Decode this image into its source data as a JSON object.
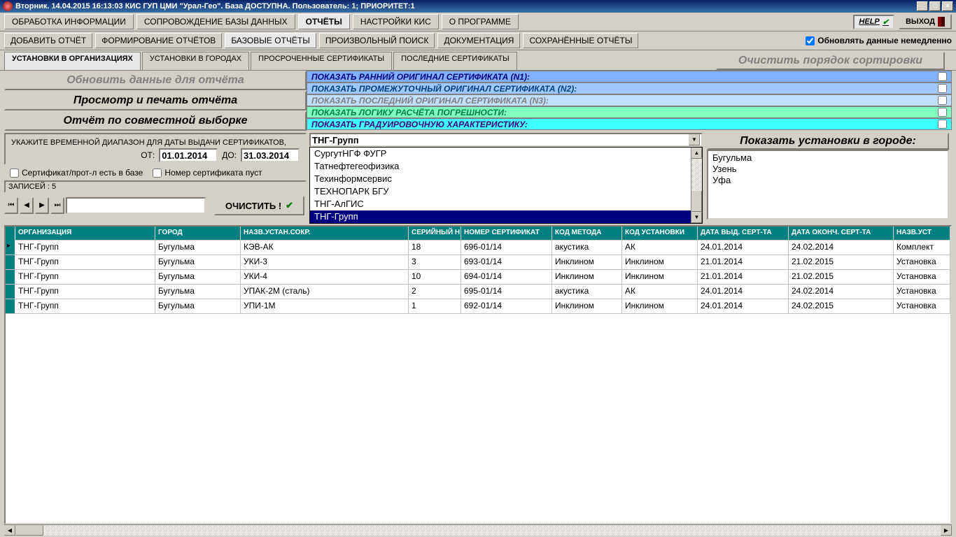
{
  "titlebar": "Вторник. 14.04.2015 16:13:03 КИС ГУП ЦМИ \"Урал-Гео\". База ДОСТУПНА. Пользователь: 1; ПРИОРИТЕТ:1",
  "menu": {
    "items": [
      "ОБРАБОТКА ИНФОРМАЦИИ",
      "СОПРОВОЖДЕНИЕ БАЗЫ ДАННЫХ",
      "ОТЧЁТЫ",
      "НАСТРОЙКИ КИС",
      "О ПРОГРАММЕ"
    ],
    "help": "HELP",
    "exit": "ВЫХОД"
  },
  "submenu": {
    "items": [
      "ДОБАВИТЬ ОТЧЁТ",
      "ФОРМИРОВАНИЕ ОТЧЁТОВ",
      "БАЗОВЫЕ ОТЧЁТЫ",
      "ПРОИЗВОЛЬНЫЙ ПОИСК",
      "ДОКУМЕНТАЦИЯ",
      "СОХРАНЁННЫЕ ОТЧЁТЫ"
    ],
    "refresh_label": "Обновлять данные немедленно"
  },
  "tabs": {
    "items": [
      "УСТАНОВКИ В ОРГАНИЗАЦИЯХ",
      "УСТАНОВКИ В ГОРОДАХ",
      "ПРОСРОЧЕННЫЕ СЕРТИФИКАТЫ",
      "ПОСЛЕДНИЕ СЕРТИФИКАТЫ"
    ],
    "sort": "Очистить порядок сортировки"
  },
  "actions": {
    "refresh": "Обновить данные для отчёта",
    "preview": "Просмотр и печать отчёта",
    "joint": "Отчёт по совместной выборке"
  },
  "showrows": [
    "ПОКАЗАТЬ РАННИЙ ОРИГИНАЛ СЕРТИФИКАТА (N1):",
    "ПОКАЗАТЬ ПРОМЕЖУТОЧНЫЙ ОРИГИНАЛ СЕРТИФИКАТА (N2):",
    "ПОКАЗАТЬ ПОСЛЕДНИЙ ОРИГИНАЛ СЕРТИФИКАТА (N3):",
    "ПОКАЗАТЬ ЛОГИКУ РАСЧЁТА ПОГРЕШНОСТИ:",
    "ПОКАЗАТЬ ГРАДУИРОВОЧНУЮ ХАРАКТЕРИСТИКУ:"
  ],
  "daterange": {
    "label": "УКАЖИТЕ ВРЕМЕННОЙ ДИАПАЗОН ДЛЯ ДАТЫ ВЫДАЧИ СЕРТИФИКАТОВ,",
    "from_label": "ОТ:",
    "from": "01.01.2014",
    "to_label": "ДО:",
    "to": "31.03.2014"
  },
  "combo": {
    "value": "ТНГ-Групп",
    "items": [
      "СургутНГФ ФУГР",
      "Татнефтегеофизика",
      "Техинформсервис",
      "ТЕХНОПАРК БГУ",
      "ТНГ-АлГИС",
      "ТНГ-Групп"
    ]
  },
  "cities": {
    "header": "Показать установки в городе:",
    "items": [
      "Бугульма",
      "Узень",
      "Уфа"
    ]
  },
  "checks": {
    "cert_in_db": "Сертификат/прот-л есть в базе",
    "cert_empty": "Номер сертификата пуст"
  },
  "records": "ЗАПИСЕЙ : 5",
  "clear": "ОЧИСТИТЬ !",
  "grid": {
    "headers": [
      "ОРГАНИЗАЦИЯ",
      "ГОРОД",
      "НАЗВ.УСТАН.СОКР.",
      "СЕРИЙНЫЙ Н",
      "НОМЕР СЕРТИФИКАТ",
      "КОД МЕТОДА",
      "КОД УСТАНОВКИ",
      "ДАТА ВЫД. СЕРТ-ТА",
      "ДАТА ОКОНЧ. СЕРТ-ТА",
      "НАЗВ.УСТ"
    ],
    "rows": [
      [
        "ТНГ-Групп",
        "Бугульма",
        "КЭВ-АК",
        "18",
        "696-01/14",
        "акустика",
        "АК",
        "24.01.2014",
        "24.02.2014",
        "Комплект"
      ],
      [
        "ТНГ-Групп",
        "Бугульма",
        "УКИ-3",
        "3",
        "693-01/14",
        "Инклином",
        "Инклином",
        "21.01.2014",
        "21.02.2015",
        "Установка"
      ],
      [
        "ТНГ-Групп",
        "Бугульма",
        "УКИ-4",
        "10",
        "694-01/14",
        "Инклином",
        "Инклином",
        "21.01.2014",
        "21.02.2015",
        "Установка"
      ],
      [
        "ТНГ-Групп",
        "Бугульма",
        "УПАК-2М (сталь)",
        "2",
        "695-01/14",
        "акустика",
        "АК",
        "24.01.2014",
        "24.02.2014",
        "Установка"
      ],
      [
        "ТНГ-Групп",
        "Бугульма",
        "УПИ-1М",
        "1",
        "692-01/14",
        "Инклином",
        "Инклином",
        "24.01.2014",
        "24.02.2015",
        "Установка"
      ]
    ]
  }
}
